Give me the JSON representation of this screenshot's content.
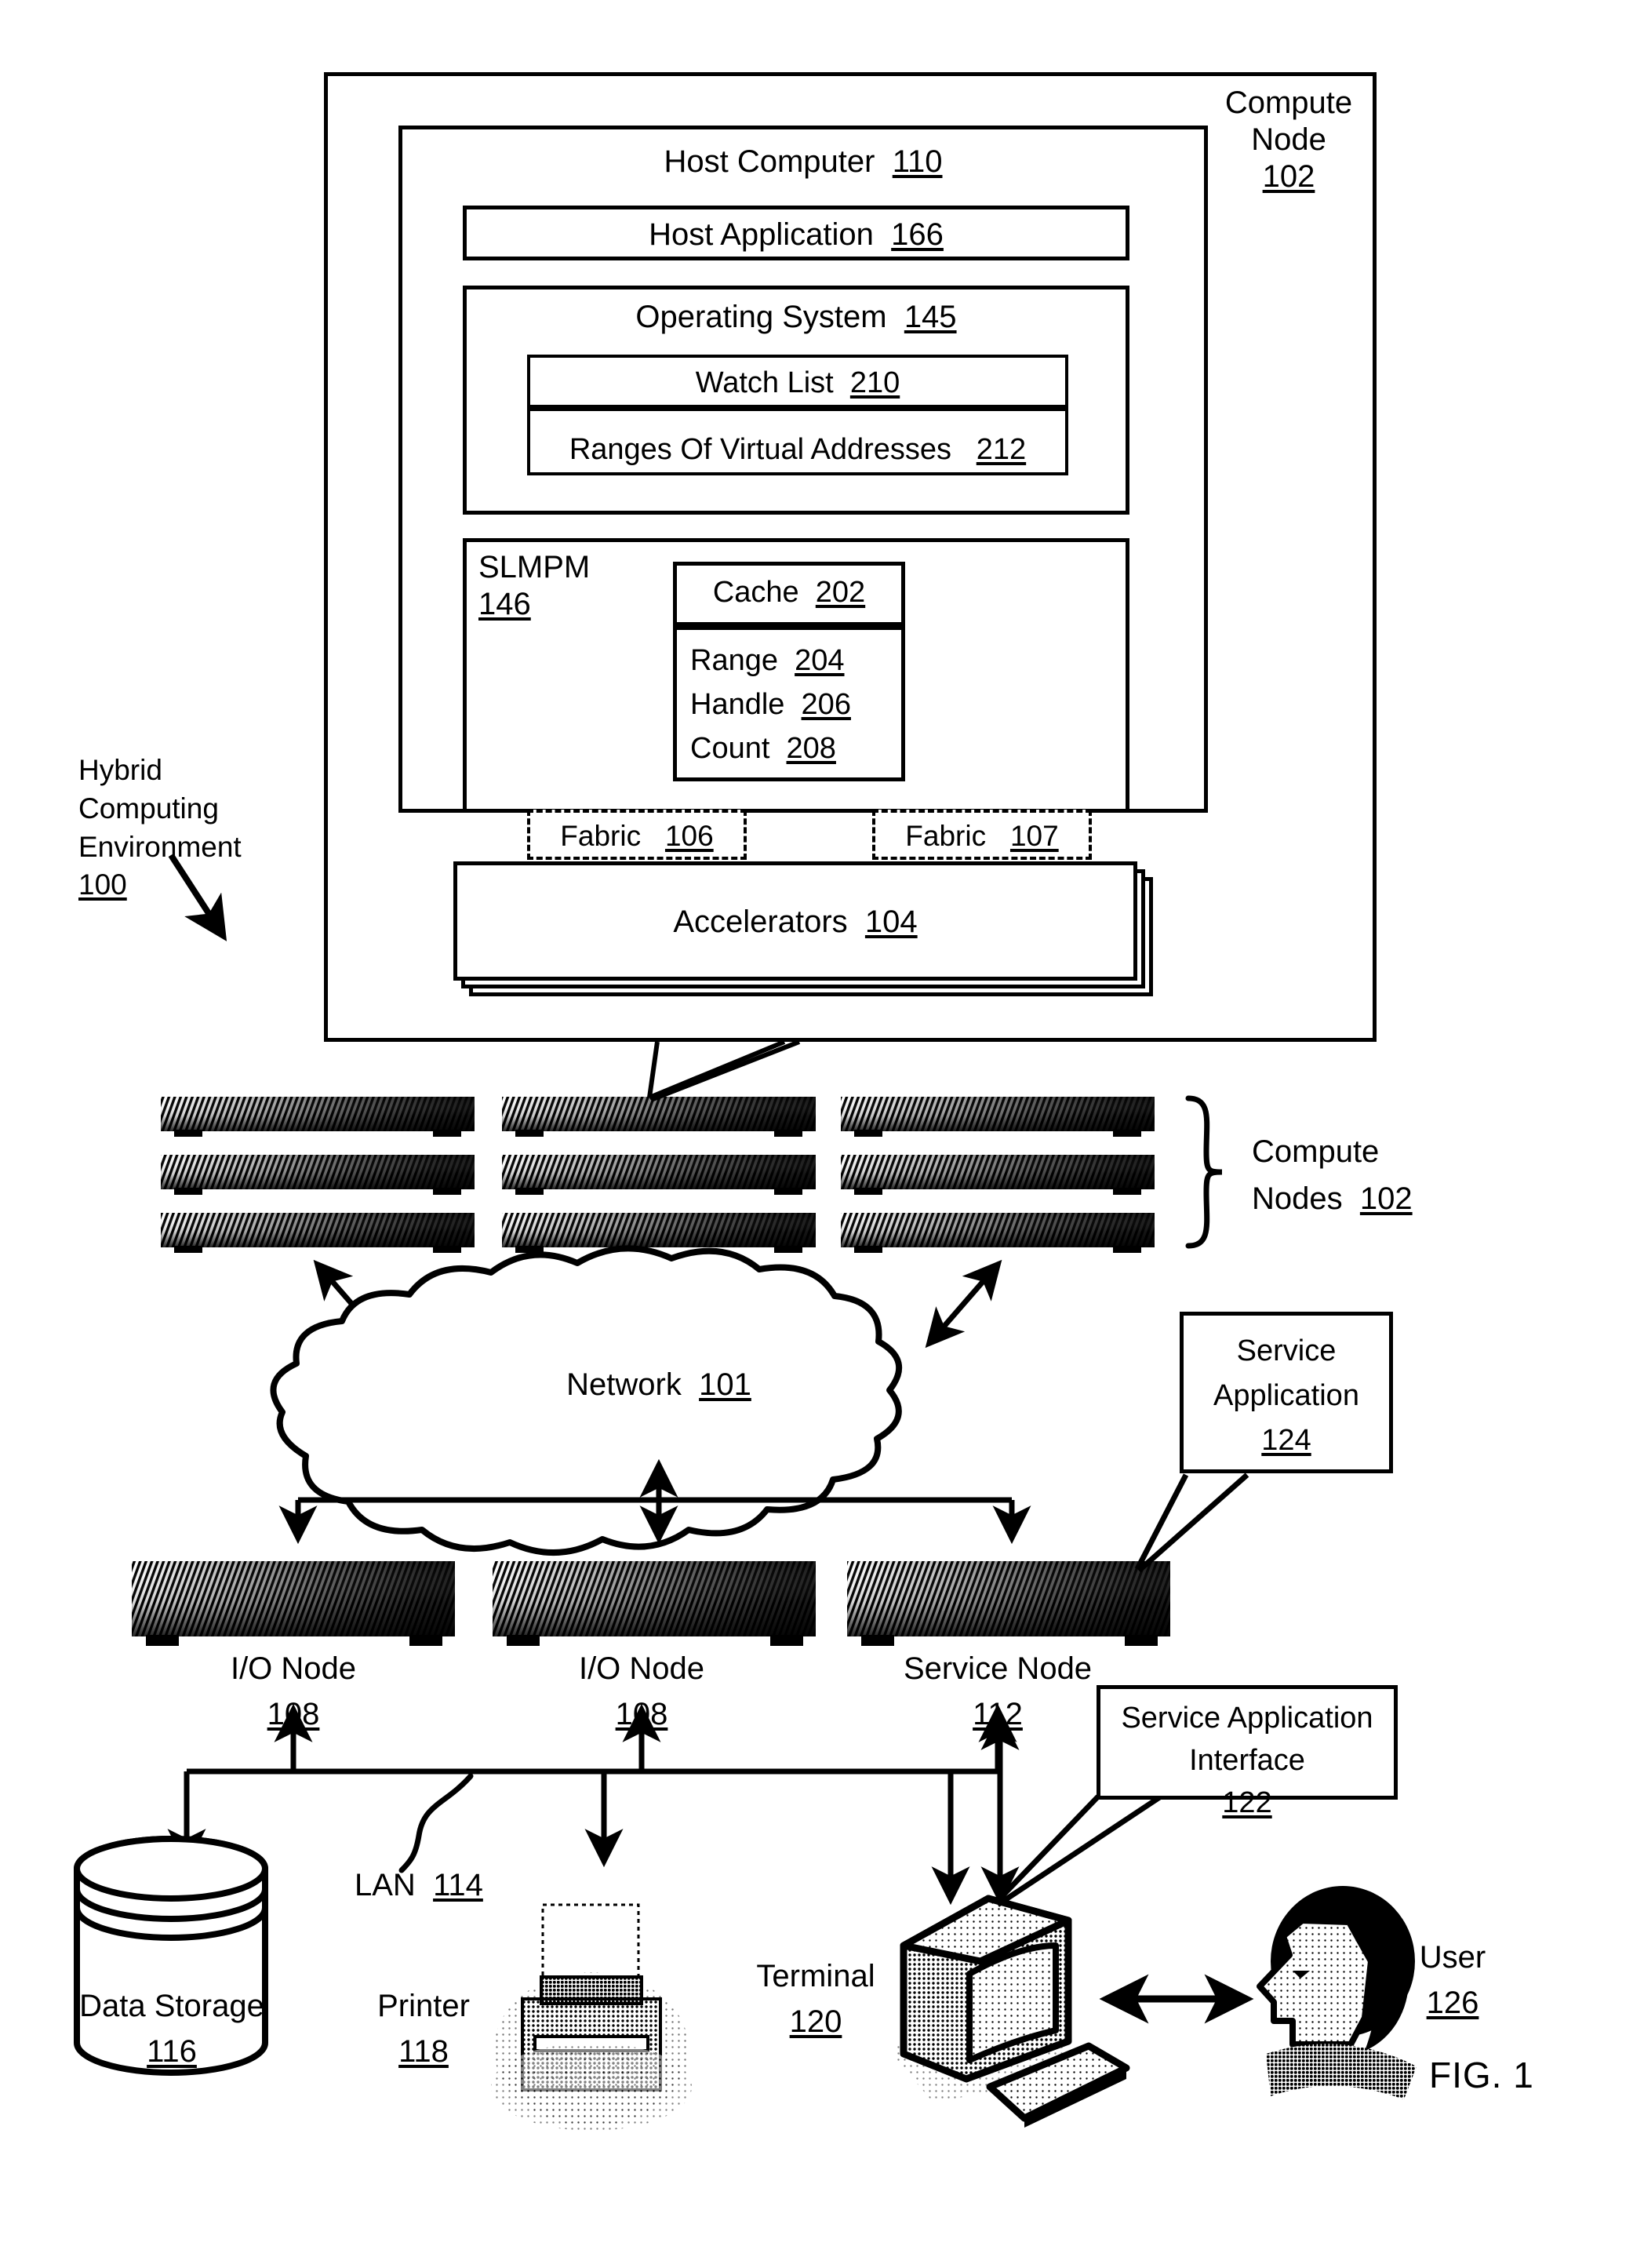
{
  "figure": {
    "caption": "FIG. 1",
    "environment_label": {
      "lines": [
        "Hybrid",
        "Computing",
        "Environment"
      ],
      "ref": "100"
    }
  },
  "compute_node_detail": {
    "title_lines": [
      "Compute",
      "Node"
    ],
    "title_ref": "102",
    "host_computer": {
      "label": "Host Computer",
      "ref": "110"
    },
    "host_application": {
      "label": "Host Application",
      "ref": "166"
    },
    "operating_system": {
      "label": "Operating System",
      "ref": "145"
    },
    "watch_list": {
      "label": "Watch List",
      "ref": "210"
    },
    "ranges_of_virtual_addresses": {
      "label": "Ranges Of Virtual Addresses",
      "ref": "212"
    },
    "slmpm": {
      "label": "SLMPM",
      "ref": "146"
    },
    "cache": {
      "label": "Cache",
      "ref": "202"
    },
    "cache_fields": [
      {
        "label": "Range",
        "ref": "204"
      },
      {
        "label": "Handle",
        "ref": "206"
      },
      {
        "label": "Count",
        "ref": "208"
      }
    ],
    "fabrics": [
      {
        "label": "Fabric",
        "ref": "106"
      },
      {
        "label": "Fabric",
        "ref": "107"
      }
    ],
    "accelerators": {
      "label": "Accelerators",
      "ref": "104"
    }
  },
  "topology": {
    "compute_nodes_brace": {
      "line1": "Compute",
      "line2": "Nodes",
      "ref": "102"
    },
    "network": {
      "label": "Network",
      "ref": "101"
    },
    "service_application": {
      "line1": "Service",
      "line2": "Application",
      "ref": "124"
    },
    "service_application_interface": {
      "line1": "Service Application",
      "line2": "Interface",
      "ref": "122"
    },
    "nodes_row": [
      {
        "label": "I/O Node",
        "ref": "108"
      },
      {
        "label": "I/O Node",
        "ref": "108"
      },
      {
        "label": "Service Node",
        "ref": "112"
      }
    ],
    "lan": {
      "label": "LAN",
      "ref": "114"
    },
    "peripherals": [
      {
        "label": "Data Storage",
        "ref": "116"
      },
      {
        "label": "Printer",
        "ref": "118"
      },
      {
        "label": "Terminal",
        "ref": "120"
      },
      {
        "label": "User",
        "ref": "126"
      }
    ]
  },
  "colors": {
    "ink": "#000000",
    "paper": "#ffffff"
  }
}
